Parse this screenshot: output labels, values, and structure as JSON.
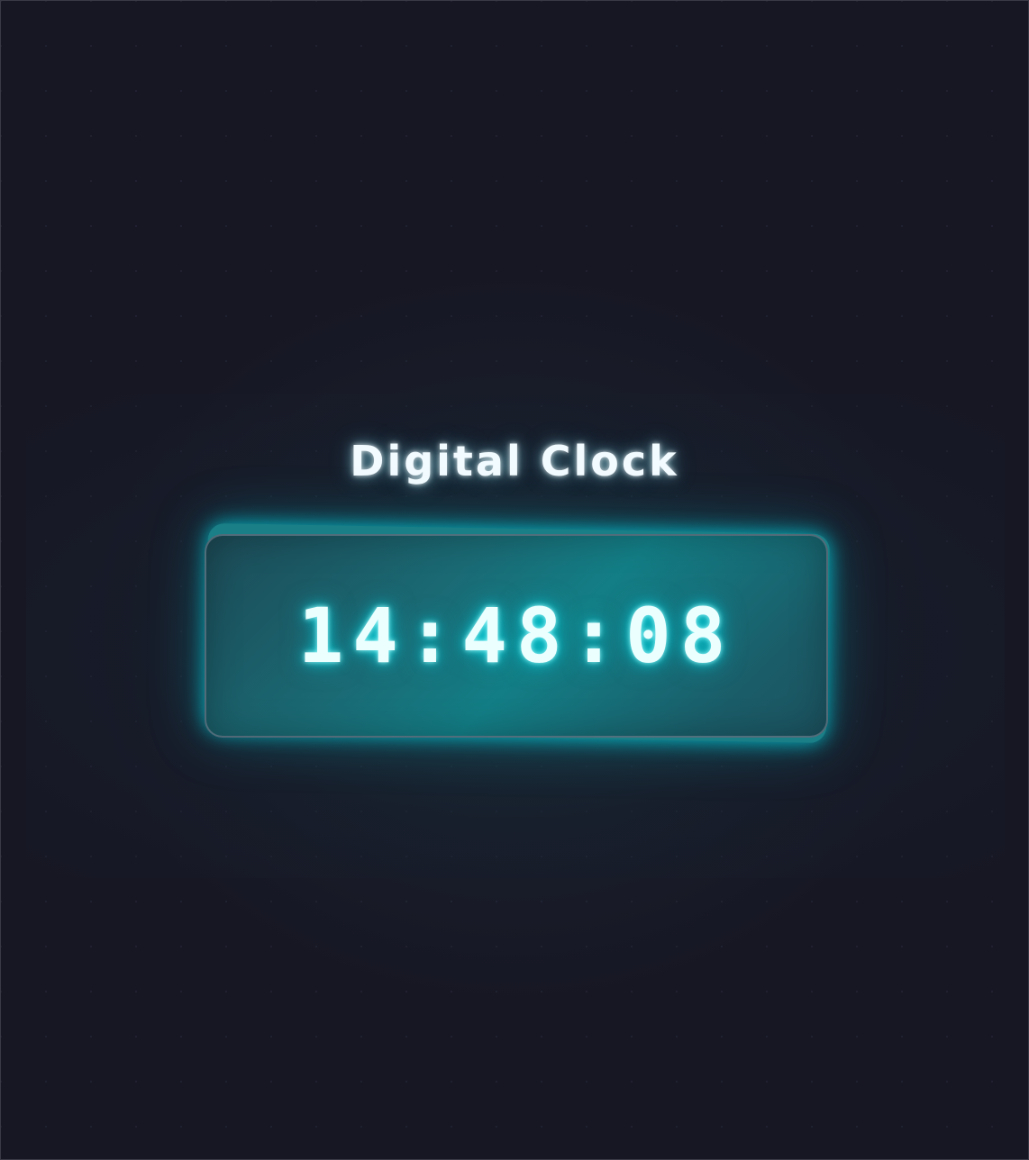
{
  "app": {
    "title": "Digital Clock"
  },
  "clock": {
    "time": "14:48:08"
  },
  "colors": {
    "background": "#171724",
    "accent_glow": "#00dce6",
    "text": "#f2fbff"
  }
}
